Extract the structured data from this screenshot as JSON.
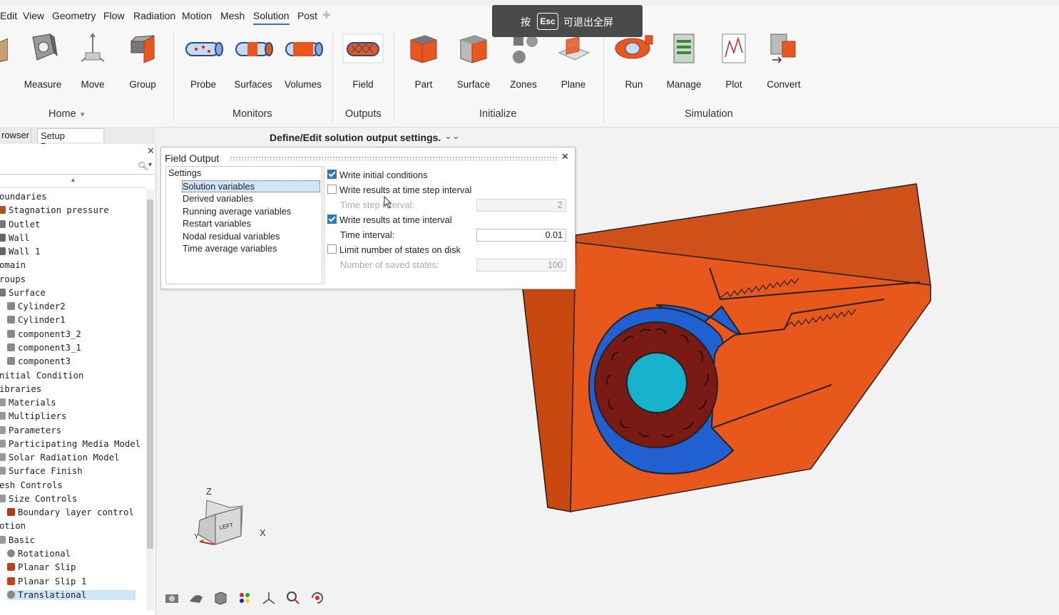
{
  "menu": {
    "items": [
      "Edit",
      "View",
      "Geometry",
      "Flow",
      "Radiation",
      "Motion",
      "Mesh",
      "Solution",
      "Post"
    ],
    "active": "Solution"
  },
  "overlay": {
    "press": "按",
    "key": "Esc",
    "exit_text": "可退出全屏"
  },
  "ribbon": {
    "tools": {
      "measure": "Measure",
      "move": "Move",
      "group": "Group",
      "probe": "Probe",
      "surfaces": "Surfaces",
      "volumes": "Volumes",
      "field": "Field",
      "part": "Part",
      "surface": "Surface",
      "zones": "Zones",
      "plane": "Plane",
      "run": "Run",
      "manage": "Manage",
      "plot": "Plot",
      "convert": "Convert"
    },
    "groups": {
      "home": "Home",
      "monitors": "Monitors",
      "outputs": "Outputs",
      "initialize": "Initialize",
      "simulation": "Simulation"
    }
  },
  "browser": {
    "tabs": {
      "model": "rowser",
      "setup": "Setup Browser"
    },
    "search_placeholder": "",
    "tree": [
      {
        "label": "oundaries",
        "indent": 0,
        "icon": "none"
      },
      {
        "label": "Stagnation pressure",
        "indent": 1,
        "icon": "stagnation-icon"
      },
      {
        "label": "Outlet",
        "indent": 1,
        "icon": "outlet-icon"
      },
      {
        "label": "Wall",
        "indent": 1,
        "icon": "wall-icon"
      },
      {
        "label": "Wall 1",
        "indent": 1,
        "icon": "wall-icon"
      },
      {
        "label": "omain",
        "indent": 0,
        "icon": "none"
      },
      {
        "label": "roups",
        "indent": 0,
        "icon": "none"
      },
      {
        "label": "Surface",
        "indent": 1,
        "icon": "group-icon"
      },
      {
        "label": "Cylinder2",
        "indent": 2,
        "icon": "surface-icon"
      },
      {
        "label": "Cylinder1",
        "indent": 2,
        "icon": "surface-icon"
      },
      {
        "label": "component3_2",
        "indent": 2,
        "icon": "surface-icon"
      },
      {
        "label": "component3_1",
        "indent": 2,
        "icon": "surface-icon"
      },
      {
        "label": "component3",
        "indent": 2,
        "icon": "surface-icon"
      },
      {
        "label": "nitial Condition",
        "indent": 0,
        "icon": "none"
      },
      {
        "label": "ibraries",
        "indent": 0,
        "icon": "none"
      },
      {
        "label": "Materials",
        "indent": 1,
        "icon": "folder-icon"
      },
      {
        "label": "Multipliers",
        "indent": 1,
        "icon": "folder-icon"
      },
      {
        "label": "Parameters",
        "indent": 1,
        "icon": "folder-icon"
      },
      {
        "label": "Participating Media Model",
        "indent": 1,
        "icon": "folder-icon"
      },
      {
        "label": "Solar Radiation Model",
        "indent": 1,
        "icon": "folder-icon"
      },
      {
        "label": "Surface Finish",
        "indent": 1,
        "icon": "folder-icon"
      },
      {
        "label": "esh Controls",
        "indent": 0,
        "icon": "none"
      },
      {
        "label": "Size Controls",
        "indent": 1,
        "icon": "folder-icon"
      },
      {
        "label": "Boundary layer control",
        "indent": 2,
        "icon": "boundary-layer-icon"
      },
      {
        "label": "otion",
        "indent": 0,
        "icon": "none"
      },
      {
        "label": "Basic",
        "indent": 1,
        "icon": "folder-icon"
      },
      {
        "label": "Rotational",
        "indent": 2,
        "icon": "rotational-icon"
      },
      {
        "label": "Planar Slip",
        "indent": 2,
        "icon": "planar-slip-icon"
      },
      {
        "label": "Planar Slip 1",
        "indent": 2,
        "icon": "planar-slip-icon"
      },
      {
        "label": "Translational",
        "indent": 2,
        "icon": "translational-icon",
        "selected": true
      }
    ]
  },
  "hint": "Define/Edit solution output settings.",
  "dialog": {
    "title": "Field Output",
    "settings_header": "Settings",
    "settings_items": [
      "Solution variables",
      "Derived variables",
      "Running average variables",
      "Restart variables",
      "Nodal residual variables",
      "Time average variables"
    ],
    "selected_setting": "Solution variables",
    "write_initial": {
      "label": "Write initial conditions",
      "checked": true
    },
    "write_step": {
      "label": "Write results at time step interval",
      "checked": false
    },
    "time_step_interval": {
      "label": "Time step interval:",
      "value": "2",
      "enabled": false
    },
    "write_time": {
      "label": "Write results at time interval",
      "checked": true
    },
    "time_interval": {
      "label": "Time interval:",
      "value": "0.01",
      "enabled": true
    },
    "limit_states": {
      "label": "Limit number of states on disk",
      "checked": false
    },
    "saved_states": {
      "label": "Number of saved states:",
      "value": "100",
      "enabled": false
    }
  },
  "viewcube": {
    "face": "LEFT",
    "axis_z": "Z",
    "axis_x": "X",
    "axis_y": "Y"
  },
  "colors": {
    "accent": "#2a7ab8",
    "part_orange": "#e8581c",
    "volute_blue": "#2060d0",
    "impeller_red": "#7a1a14",
    "hub_cyan": "#17b2cc",
    "selection": "#cfe6f7"
  }
}
